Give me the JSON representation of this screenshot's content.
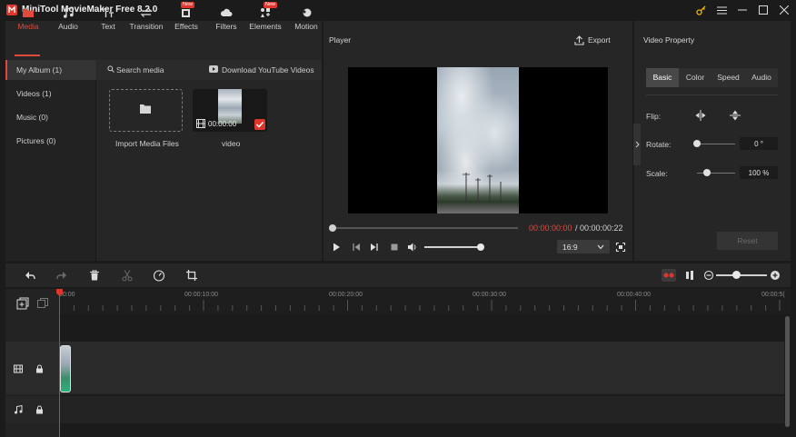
{
  "app": {
    "title": "MiniTool MovieMaker Free 8.2.0"
  },
  "toolbar": {
    "tools": [
      {
        "label": "Media",
        "active": true
      },
      {
        "label": "Audio"
      },
      {
        "label": "Text"
      },
      {
        "label": "Transition"
      },
      {
        "label": "Effects",
        "badge": "New"
      },
      {
        "label": "Filters"
      },
      {
        "label": "Elements",
        "badge": "New"
      },
      {
        "label": "Motion"
      }
    ]
  },
  "library": {
    "albums": [
      "My Album (1)",
      "Videos (1)",
      "Music (0)",
      "Pictures (0)"
    ],
    "search_label": "Search media",
    "youtube_label": "Download YouTube Videos",
    "import_label": "Import Media Files",
    "video_label": "video",
    "video_duration": "00:00:00"
  },
  "player": {
    "title": "Player",
    "export_label": "Export",
    "time_current": "00:00:00:00",
    "time_total": "/ 00:00:00:22",
    "ratio": "16:9"
  },
  "property": {
    "title": "Video Property",
    "tabs": [
      "Basic",
      "Color",
      "Speed",
      "Audio"
    ],
    "flip_label": "Flip:",
    "rotate_label": "Rotate:",
    "rotate_value": "0 °",
    "scale_label": "Scale:",
    "scale_value": "100 %",
    "reset_label": "Reset"
  },
  "timeline": {
    "ticks": [
      "00:00",
      "00:00:10:00",
      "00:00:20:00",
      "00:00:30:00",
      "00:00:40:00",
      "00:00:5("
    ]
  },
  "colors": {
    "accent": "#e04a3c",
    "badge": "#e0352b"
  }
}
